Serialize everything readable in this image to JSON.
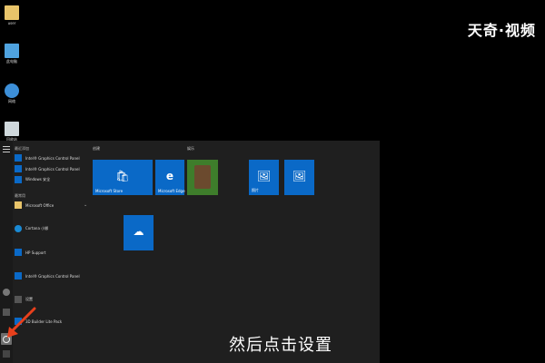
{
  "watermark": "天奇·视频",
  "desktop": {
    "icons": [
      {
        "name": "user-folder",
        "label": "user"
      },
      {
        "name": "this-pc",
        "label": "此电脑"
      },
      {
        "name": "network",
        "label": "网络"
      },
      {
        "name": "recycle-bin",
        "label": "回收站"
      }
    ]
  },
  "start_menu": {
    "app_list": {
      "recent_header": "最近添加",
      "recent_items": [
        "Intel® Graphics Control Panel",
        "Intel® Graphics Control Panel",
        "Windows 安全"
      ],
      "section_header": "最常用",
      "items": [
        {
          "label": "Microsoft Office",
          "expandable": true
        },
        {
          "label": "Cortana 小娜",
          "expandable": false
        },
        {
          "label": "HP Support",
          "expandable": false
        },
        {
          "label": "Intel® Graphics Control Panel",
          "expandable": false
        },
        {
          "label": "设置",
          "expandable": false
        },
        {
          "label": "3D Builder Lite Pack",
          "expandable": false
        }
      ]
    },
    "groups": [
      {
        "title": "创建"
      },
      {
        "title": "娱乐"
      }
    ],
    "tiles": [
      {
        "name": "microsoft-store",
        "label": "Microsoft Store",
        "glyph": "🛍"
      },
      {
        "name": "microsoft-edge",
        "label": "Microsoft Edge",
        "glyph": "e"
      },
      {
        "name": "xbox-game",
        "label": "",
        "glyph": ""
      },
      {
        "name": "photos",
        "label": "照片",
        "glyph": "🖼"
      },
      {
        "name": "photos-2",
        "label": "",
        "glyph": "🖼"
      },
      {
        "name": "onedrive",
        "label": "",
        "glyph": "☁"
      }
    ]
  },
  "caption": "然后点击设置",
  "colors": {
    "accent": "#0a69c7",
    "menu_bg": "#1f1f1f",
    "arrow": "#e8401c"
  }
}
